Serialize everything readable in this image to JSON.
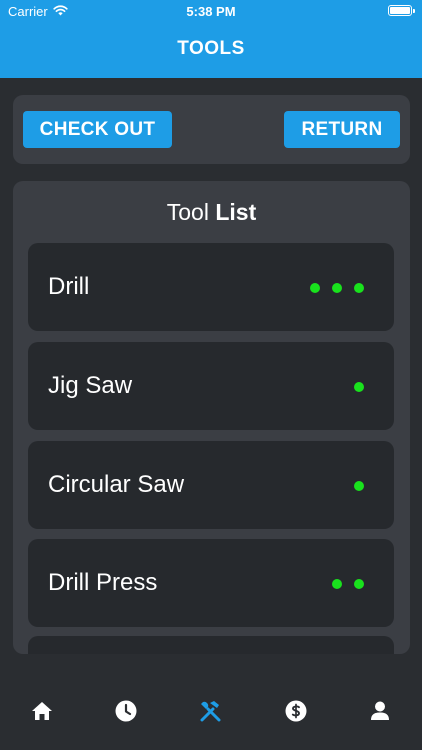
{
  "status_bar": {
    "carrier": "Carrier",
    "time": "5:38 PM"
  },
  "header": {
    "title": "TOOLS"
  },
  "actions": {
    "check_out_label": "CHECK OUT",
    "return_label": "RETURN"
  },
  "tool_list": {
    "title_light": "Tool",
    "title_bold": "List",
    "items": [
      {
        "name": "Drill",
        "available_count": 3
      },
      {
        "name": "Jig Saw",
        "available_count": 1
      },
      {
        "name": "Circular Saw",
        "available_count": 1
      },
      {
        "name": "Drill Press",
        "available_count": 2
      }
    ]
  },
  "tabbar": {
    "tabs": [
      {
        "icon": "home-icon",
        "active": false
      },
      {
        "icon": "clock-icon",
        "active": false
      },
      {
        "icon": "tools-icon",
        "active": true
      },
      {
        "icon": "dollar-icon",
        "active": false
      },
      {
        "icon": "user-icon",
        "active": false
      }
    ]
  },
  "colors": {
    "accent": "#1e9de6",
    "background": "#2a2d31",
    "panel": "#3b3e44",
    "card": "#26292d",
    "indicator": "#19e21d"
  }
}
